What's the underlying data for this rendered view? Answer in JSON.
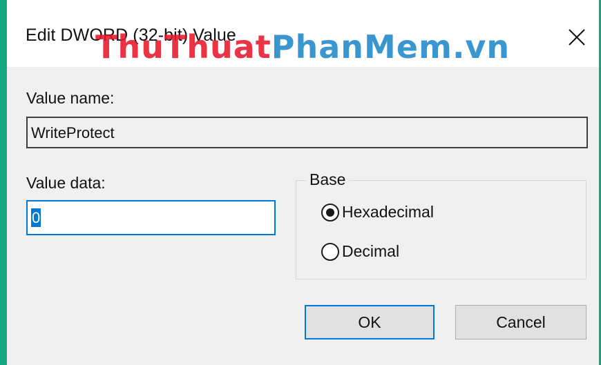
{
  "window": {
    "title": "Edit DWORD (32-bit) Value",
    "close_icon": "close-icon"
  },
  "watermark": {
    "part1": "ThuThuat",
    "part2": "PhanMem",
    "part3": ".vn",
    "color1": "#e8192c",
    "color2": "#1f88c8"
  },
  "fields": {
    "value_name_label": "Value name:",
    "value_name": "WriteProtect",
    "value_data_label": "Value data:",
    "value_data": "0"
  },
  "base": {
    "legend": "Base",
    "options": [
      {
        "label": "Hexadecimal",
        "selected": true
      },
      {
        "label": "Decimal",
        "selected": false
      }
    ]
  },
  "buttons": {
    "ok": "OK",
    "cancel": "Cancel"
  },
  "colors": {
    "frame_accent": "#16a581",
    "focus_blue": "#0078d7",
    "dialog_bg": "#f0f0f0"
  }
}
